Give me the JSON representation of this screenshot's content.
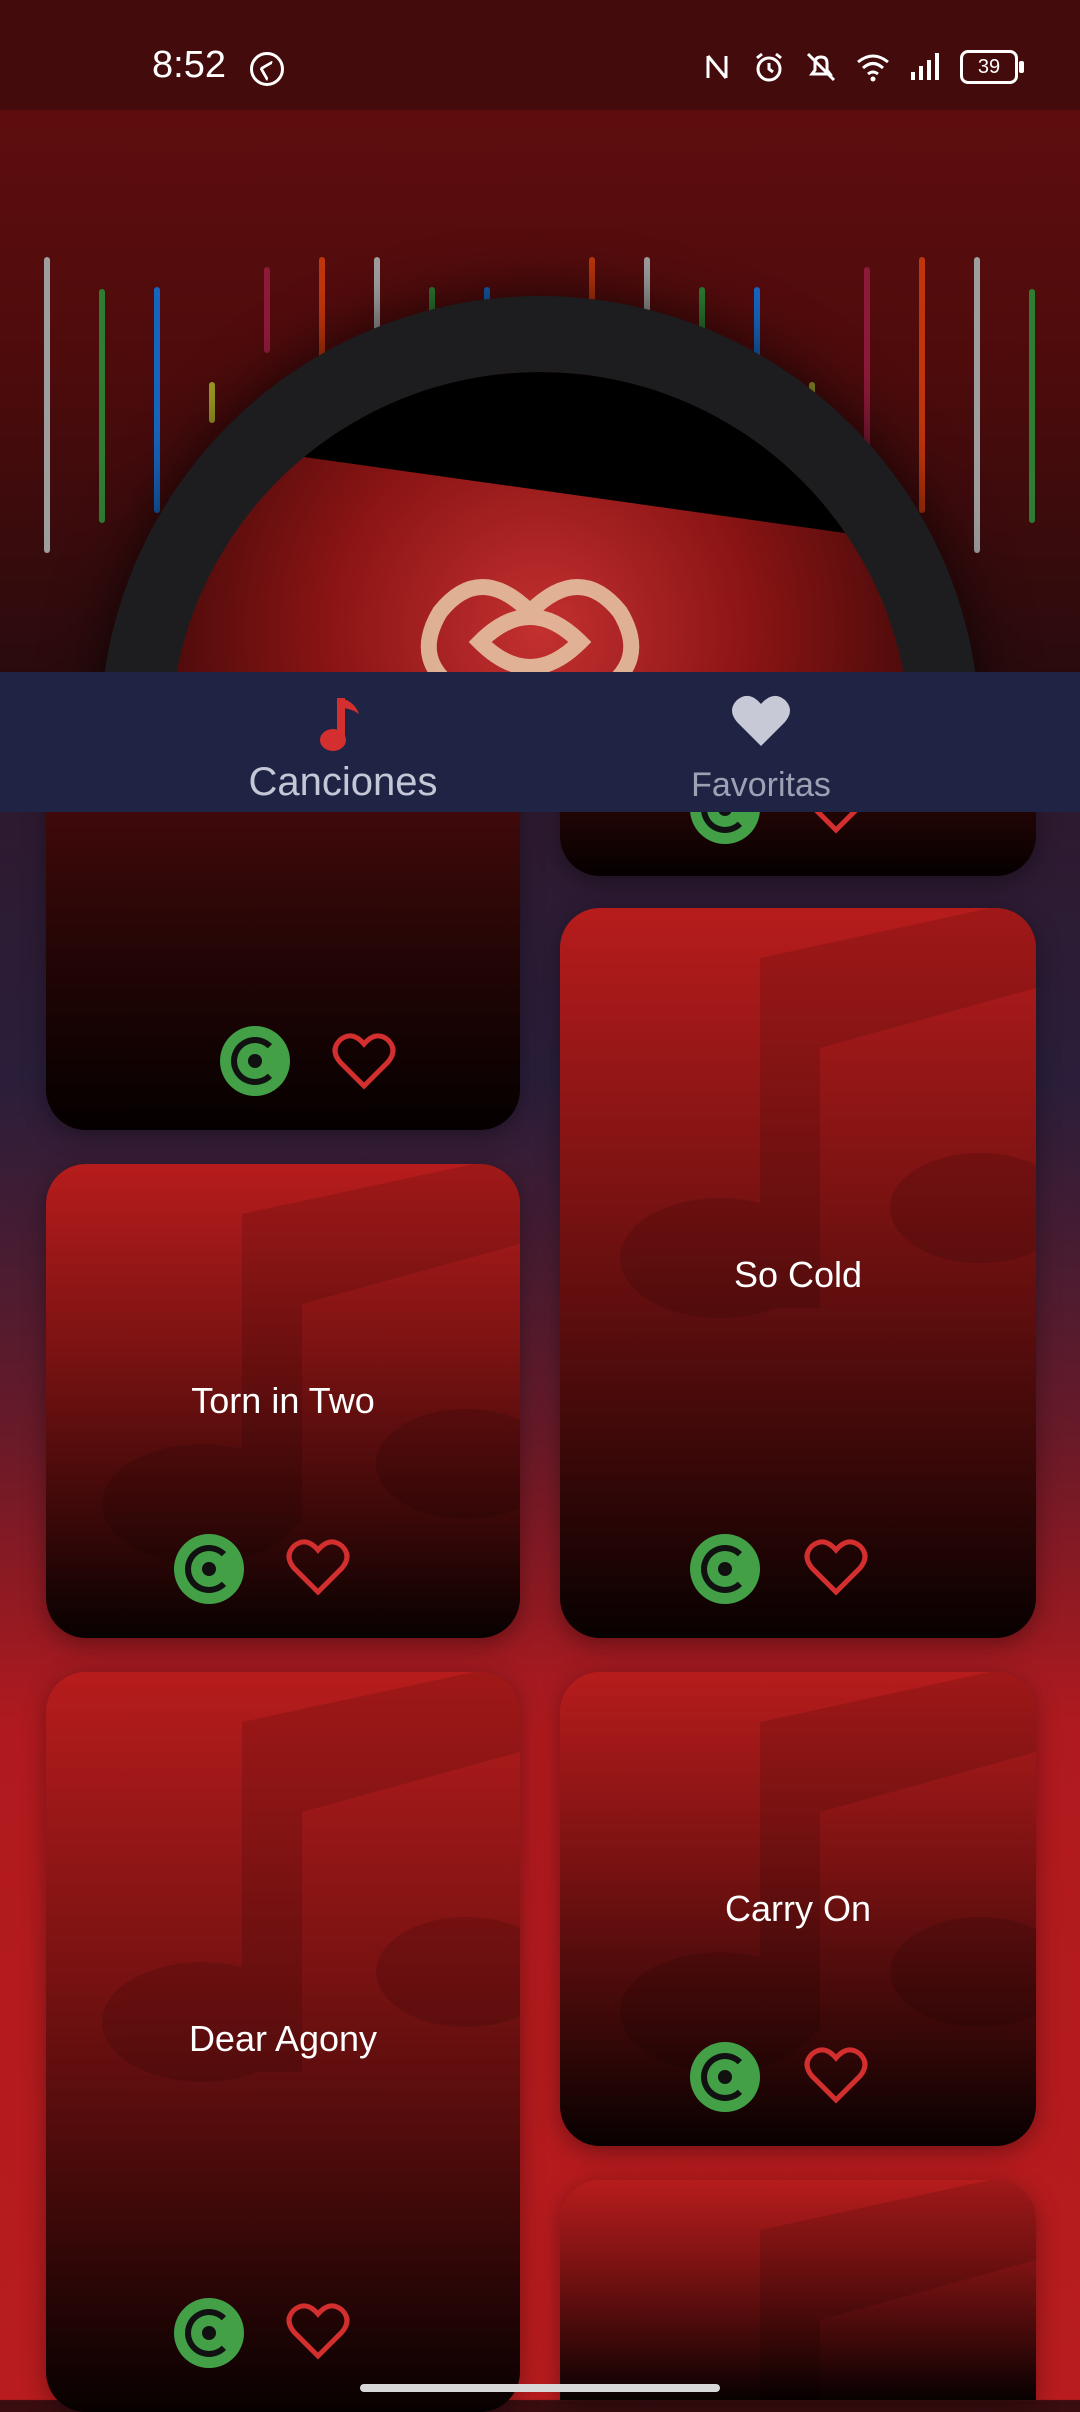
{
  "status_bar": {
    "time": "8:52",
    "battery": "39"
  },
  "tabs": [
    {
      "label": "Canciones",
      "icon": "music-note-icon",
      "active": true
    },
    {
      "label": "Favoritas",
      "icon": "heart-icon",
      "active": false
    }
  ],
  "songs": [
    {
      "title": ""
    },
    {
      "title": ""
    },
    {
      "title": "So Cold"
    },
    {
      "title": "Torn in Two"
    },
    {
      "title": "Dear Agony"
    },
    {
      "title": "Carry On"
    },
    {
      "title": ""
    }
  ],
  "colors": {
    "accent_red": "#d32f2f",
    "play_green": "#43a047",
    "tabbar": "#1f2444"
  }
}
